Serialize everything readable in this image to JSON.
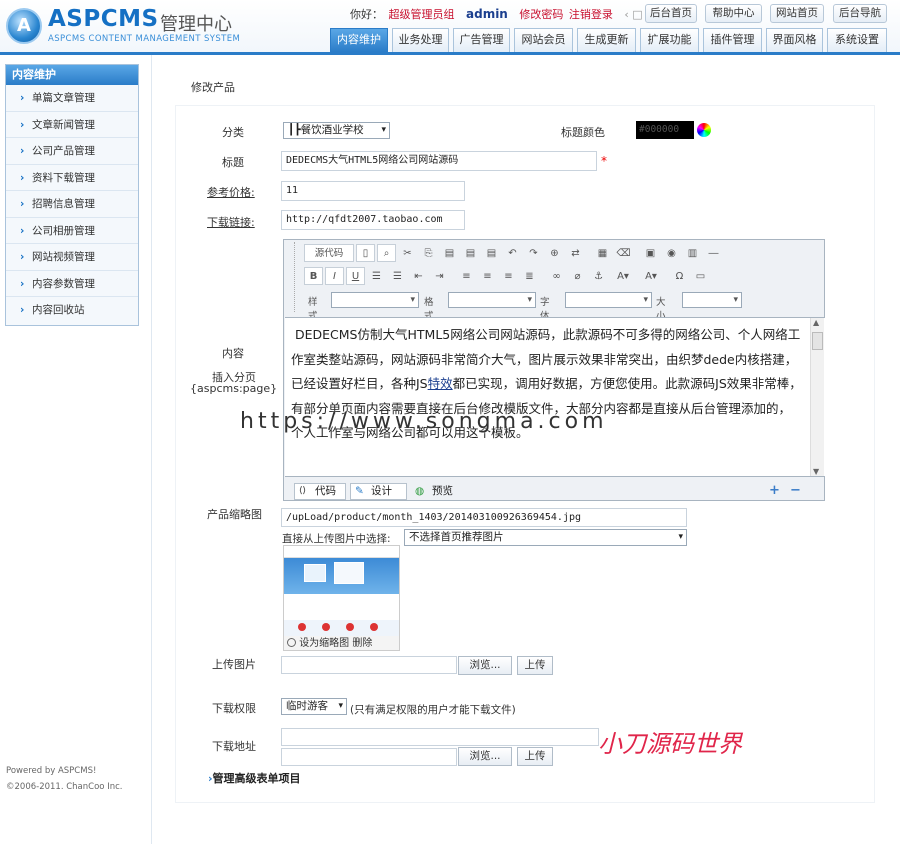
{
  "header": {
    "logo_mark": "A",
    "logo_text": "ASPCMS",
    "logo_cn": "管理中心",
    "logo_sub": "ASPCMS CONTENT MANAGEMENT SYSTEM",
    "greeting": "你好：",
    "role": "超级管理员组",
    "username": "admin",
    "change_password": "修改密码",
    "logout": "注销登录",
    "top_buttons": [
      "后台首页",
      "帮助中心",
      "网站首页",
      "后台导航"
    ],
    "nav_tabs": [
      "内容维护",
      "业务处理",
      "广告管理",
      "网站会员",
      "生成更新",
      "扩展功能",
      "插件管理",
      "界面风格",
      "系统设置"
    ],
    "active_tab": "内容维护"
  },
  "sidebar": {
    "title": "内容维护",
    "items": [
      "单篇文章管理",
      "文章新闻管理",
      "公司产品管理",
      "资料下载管理",
      "招聘信息管理",
      "公司相册管理",
      "网站视频管理",
      "内容参数管理",
      "内容回收站"
    ],
    "footer_line1": "Powered by ASPCMS!",
    "footer_line2": "©2006-2011. ChanCoo Inc."
  },
  "page_title": "修改产品",
  "form": {
    "category_label": "分类",
    "category_value": "┃┣餐饮酒业学校",
    "title_color_label": "标题颜色",
    "title_color_value": "#000000",
    "title_label": "标题",
    "title_value": "DEDECMS大气HTML5网络公司网站源码",
    "required_mark": "*",
    "price_label": "参考价格:",
    "price_value": "11",
    "download_link_label": "下载链接:",
    "download_link_value": "http://qfdt2007.taobao.com",
    "content_label": "内容",
    "insert_page_label": "插入分页",
    "insert_page_code": "{aspcms:page}",
    "thumb_label": "产品缩略图",
    "thumb_path": "/upLoad/product/month_1403/201403100926369454.jpg",
    "choose_from_uploaded_label": "直接从上传图片中选择:",
    "choose_select_value": "不选择首页推荐图片",
    "set_thumb_label": "设为缩略图",
    "delete_label": "删除",
    "upload_image_label": "上传图片",
    "browse_label": "浏览...",
    "upload_button": "上传",
    "download_perm_label": "下载权限",
    "download_perm_value": "临时游客",
    "download_perm_note": "(只有满足权限的用户才能下载文件)",
    "download_addr_label": "下载地址",
    "advanced_label": "管理高级表单项目"
  },
  "editor": {
    "source_label": "源代码",
    "style_label": "样式",
    "format_label": "格式",
    "font_label": "字体",
    "size_label": "大小",
    "content_before_link": "DEDECMS仿制大气HTML5网络公司网站源码，此款源码不可多得的网络公司、个人网络工作室类整站源码，网站源码非常简介大气，图片展示效果非常突出，由织梦dede内核搭建，已经设置好栏目，各种JS",
    "content_link": "特效",
    "content_after_link": "都已实现，调用好数据，方便您使用。此款源码JS效果非常棒，有部分单页面内容需要直接在后台修改模版文件，大部分内容都是直接从后台管理添加的，个人工作室与网络公司都可以用这个模板。",
    "tab_code": "代码",
    "tab_design": "设计",
    "tab_preview": "预览"
  },
  "watermarks": {
    "url": "https://www.songma.com",
    "brand": "小刀源码世界"
  },
  "colors": {
    "accent_blue": "#2a7cc8",
    "link_red": "#c8102e",
    "brand_watermark": "#e0254a"
  }
}
